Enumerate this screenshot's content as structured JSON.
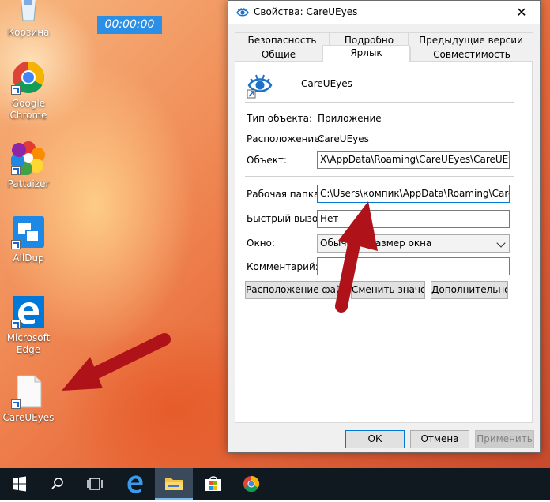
{
  "desktop": {
    "timer": "00:00:00",
    "icons": [
      {
        "label": "Корзина"
      },
      {
        "label": "Google Chrome"
      },
      {
        "label": "Pattaizer"
      },
      {
        "label": "AllDup"
      },
      {
        "label": "Microsoft Edge"
      },
      {
        "label": "CareUEyes"
      }
    ]
  },
  "dialog": {
    "title": "Свойства: CareUEyes",
    "close": "✕",
    "tabs_row1": [
      "Безопасность",
      "Подробно",
      "Предыдущие версии"
    ],
    "tabs_row2": [
      "Общие",
      "Ярлык",
      "Совместимость"
    ],
    "active_tab": "Ярлык",
    "app_name": "CareUEyes",
    "type_label": "Тип объекта:",
    "type_value": "Приложение",
    "location_label": "Расположение:",
    "location_value": "CareUEyes",
    "target_label": "Объект:",
    "target_value": "X\\AppData\\Roaming\\CareUEyes\\CareUEyes.exe",
    "workdir_label": "Рабочая папка:",
    "workdir_value": "C:\\Users\\компик\\AppData\\Roaming\\CareUEyes",
    "hotkey_label": "Быстрый вызов:",
    "hotkey_value": "Нет",
    "window_label": "Окно:",
    "window_value": "Обычный размер окна",
    "comment_label": "Комментарий:",
    "comment_value": "",
    "open_location_btn": "Расположение файла",
    "change_icon_btn": "Сменить значок...",
    "advanced_btn": "Дополнительно...",
    "ok_btn": "ОК",
    "cancel_btn": "Отмена",
    "apply_btn": "Применить"
  },
  "colors": {
    "accent": "#0078d7",
    "timer_bg": "#2b8fe6",
    "arrow": "#b0121a",
    "taskbar": "#101820"
  }
}
